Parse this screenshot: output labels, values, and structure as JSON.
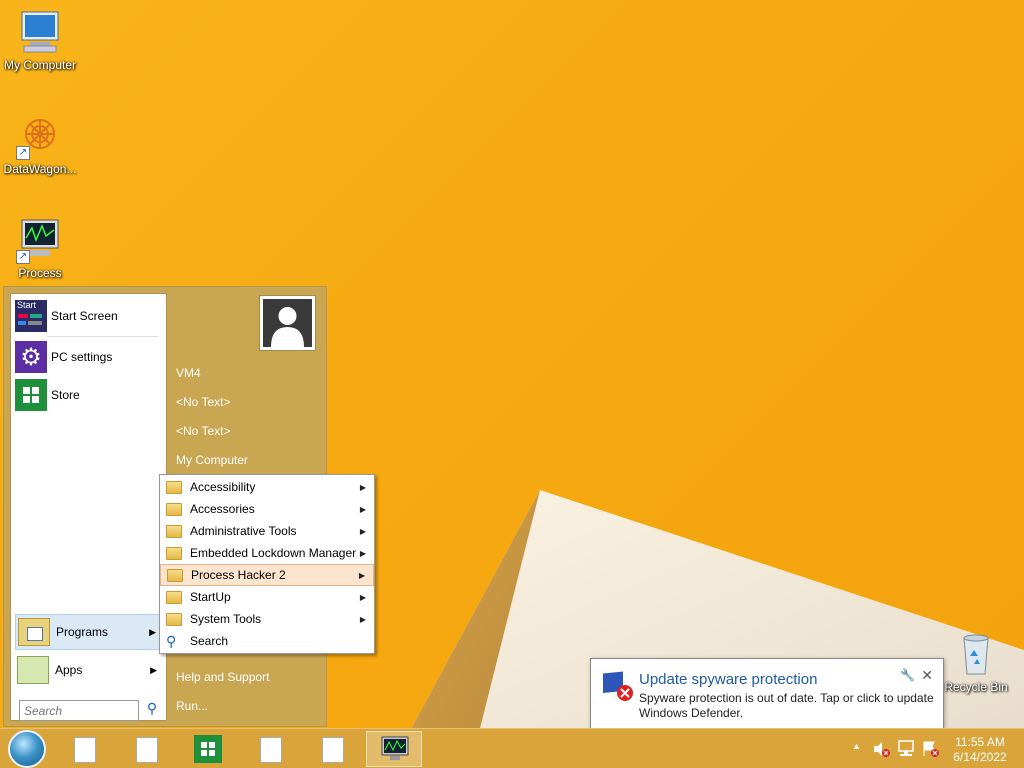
{
  "desktop": {
    "icons": [
      {
        "label": "My Computer"
      },
      {
        "label": "DataWagon..."
      },
      {
        "label": "Process"
      },
      {
        "label": "Recycle Bin"
      }
    ]
  },
  "start_menu": {
    "pinned": [
      {
        "label": "Start Screen",
        "icon": "start-screen-icon"
      },
      {
        "label": "PC settings",
        "icon": "gear-icon"
      },
      {
        "label": "Store",
        "icon": "store-icon"
      }
    ],
    "programs_label": "Programs",
    "apps_label": "Apps",
    "search_placeholder": "Search",
    "right": {
      "user": "VM4",
      "item1": "<No Text>",
      "item2": "<No Text>",
      "my_computer": "My Computer",
      "help": "Help and Support",
      "run": "Run..."
    }
  },
  "programs_submenu": {
    "items": [
      {
        "label": "Accessibility",
        "has_sub": true
      },
      {
        "label": "Accessories",
        "has_sub": true
      },
      {
        "label": "Administrative Tools",
        "has_sub": true
      },
      {
        "label": "Embedded Lockdown Manager",
        "has_sub": true
      },
      {
        "label": "Process Hacker 2",
        "has_sub": true,
        "highlighted": true
      },
      {
        "label": "StartUp",
        "has_sub": true
      },
      {
        "label": "System Tools",
        "has_sub": true
      },
      {
        "label": "Search",
        "has_sub": false
      }
    ]
  },
  "notification": {
    "title": "Update spyware protection",
    "body": "Spyware protection is out of date. Tap or click to update Windows Defender."
  },
  "taskbar": {
    "time": "11:55 AM",
    "date": "6/14/2022"
  },
  "colors": {
    "accent": "#1e5aa5",
    "start_menu_bg": "#c9a652",
    "taskbar_bg": "#d9a43a",
    "highlight": "#fce4cf"
  }
}
